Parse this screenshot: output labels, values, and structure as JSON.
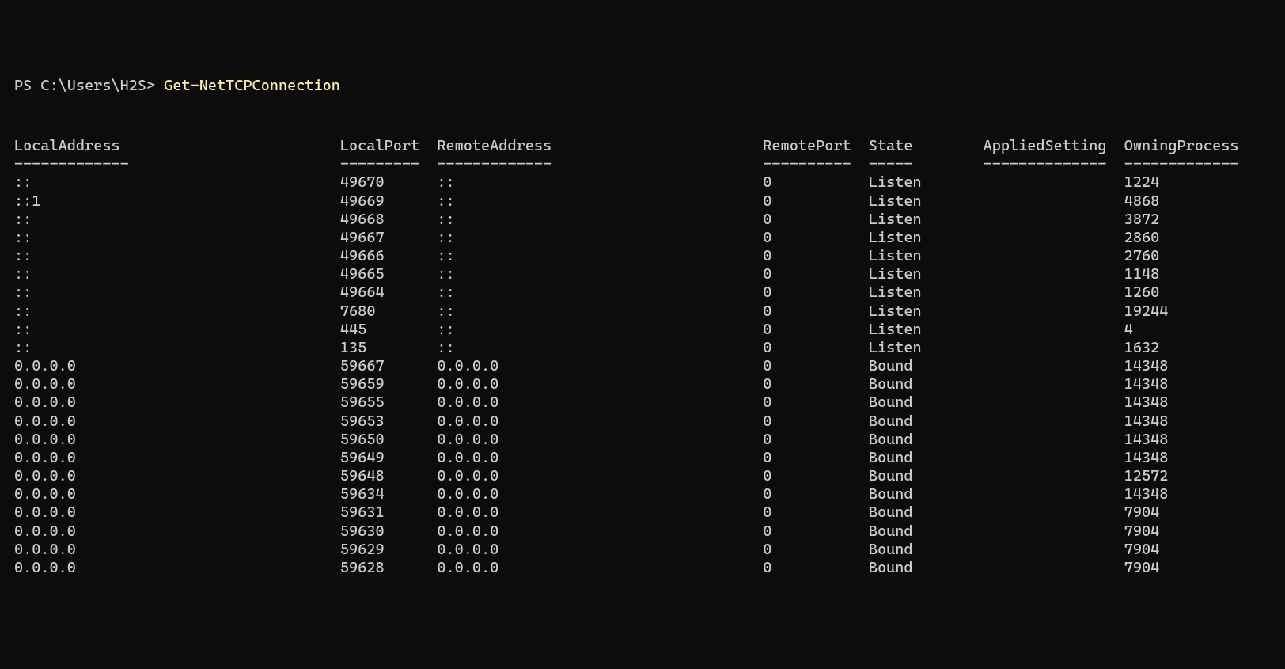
{
  "prompt": {
    "prefix": "PS C:\\Users\\H2S>",
    "command": "Get-NetTCPConnection"
  },
  "columns": [
    {
      "name": "LocalAddress",
      "width": 36,
      "rule": 13
    },
    {
      "name": "LocalPort",
      "width": 10,
      "rule": 9
    },
    {
      "name": "RemoteAddress",
      "width": 36,
      "rule": 13
    },
    {
      "name": "RemotePort",
      "width": 11,
      "rule": 10
    },
    {
      "name": "State",
      "width": 12,
      "rule": 5
    },
    {
      "name": "AppliedSetting",
      "width": 15,
      "rule": 14
    },
    {
      "name": "OwningProcess",
      "width": 14,
      "rule": 13
    }
  ],
  "rows": [
    {
      "LocalAddress": "::",
      "LocalPort": "49670",
      "RemoteAddress": "::",
      "RemotePort": "0",
      "State": "Listen",
      "AppliedSetting": "",
      "OwningProcess": "1224"
    },
    {
      "LocalAddress": "::1",
      "LocalPort": "49669",
      "RemoteAddress": "::",
      "RemotePort": "0",
      "State": "Listen",
      "AppliedSetting": "",
      "OwningProcess": "4868"
    },
    {
      "LocalAddress": "::",
      "LocalPort": "49668",
      "RemoteAddress": "::",
      "RemotePort": "0",
      "State": "Listen",
      "AppliedSetting": "",
      "OwningProcess": "3872"
    },
    {
      "LocalAddress": "::",
      "LocalPort": "49667",
      "RemoteAddress": "::",
      "RemotePort": "0",
      "State": "Listen",
      "AppliedSetting": "",
      "OwningProcess": "2860"
    },
    {
      "LocalAddress": "::",
      "LocalPort": "49666",
      "RemoteAddress": "::",
      "RemotePort": "0",
      "State": "Listen",
      "AppliedSetting": "",
      "OwningProcess": "2760"
    },
    {
      "LocalAddress": "::",
      "LocalPort": "49665",
      "RemoteAddress": "::",
      "RemotePort": "0",
      "State": "Listen",
      "AppliedSetting": "",
      "OwningProcess": "1148"
    },
    {
      "LocalAddress": "::",
      "LocalPort": "49664",
      "RemoteAddress": "::",
      "RemotePort": "0",
      "State": "Listen",
      "AppliedSetting": "",
      "OwningProcess": "1260"
    },
    {
      "LocalAddress": "::",
      "LocalPort": "7680",
      "RemoteAddress": "::",
      "RemotePort": "0",
      "State": "Listen",
      "AppliedSetting": "",
      "OwningProcess": "19244"
    },
    {
      "LocalAddress": "::",
      "LocalPort": "445",
      "RemoteAddress": "::",
      "RemotePort": "0",
      "State": "Listen",
      "AppliedSetting": "",
      "OwningProcess": "4"
    },
    {
      "LocalAddress": "::",
      "LocalPort": "135",
      "RemoteAddress": "::",
      "RemotePort": "0",
      "State": "Listen",
      "AppliedSetting": "",
      "OwningProcess": "1632"
    },
    {
      "LocalAddress": "0.0.0.0",
      "LocalPort": "59667",
      "RemoteAddress": "0.0.0.0",
      "RemotePort": "0",
      "State": "Bound",
      "AppliedSetting": "",
      "OwningProcess": "14348"
    },
    {
      "LocalAddress": "0.0.0.0",
      "LocalPort": "59659",
      "RemoteAddress": "0.0.0.0",
      "RemotePort": "0",
      "State": "Bound",
      "AppliedSetting": "",
      "OwningProcess": "14348"
    },
    {
      "LocalAddress": "0.0.0.0",
      "LocalPort": "59655",
      "RemoteAddress": "0.0.0.0",
      "RemotePort": "0",
      "State": "Bound",
      "AppliedSetting": "",
      "OwningProcess": "14348"
    },
    {
      "LocalAddress": "0.0.0.0",
      "LocalPort": "59653",
      "RemoteAddress": "0.0.0.0",
      "RemotePort": "0",
      "State": "Bound",
      "AppliedSetting": "",
      "OwningProcess": "14348"
    },
    {
      "LocalAddress": "0.0.0.0",
      "LocalPort": "59650",
      "RemoteAddress": "0.0.0.0",
      "RemotePort": "0",
      "State": "Bound",
      "AppliedSetting": "",
      "OwningProcess": "14348"
    },
    {
      "LocalAddress": "0.0.0.0",
      "LocalPort": "59649",
      "RemoteAddress": "0.0.0.0",
      "RemotePort": "0",
      "State": "Bound",
      "AppliedSetting": "",
      "OwningProcess": "14348"
    },
    {
      "LocalAddress": "0.0.0.0",
      "LocalPort": "59648",
      "RemoteAddress": "0.0.0.0",
      "RemotePort": "0",
      "State": "Bound",
      "AppliedSetting": "",
      "OwningProcess": "12572"
    },
    {
      "LocalAddress": "0.0.0.0",
      "LocalPort": "59634",
      "RemoteAddress": "0.0.0.0",
      "RemotePort": "0",
      "State": "Bound",
      "AppliedSetting": "",
      "OwningProcess": "14348"
    },
    {
      "LocalAddress": "0.0.0.0",
      "LocalPort": "59631",
      "RemoteAddress": "0.0.0.0",
      "RemotePort": "0",
      "State": "Bound",
      "AppliedSetting": "",
      "OwningProcess": "7904"
    },
    {
      "LocalAddress": "0.0.0.0",
      "LocalPort": "59630",
      "RemoteAddress": "0.0.0.0",
      "RemotePort": "0",
      "State": "Bound",
      "AppliedSetting": "",
      "OwningProcess": "7904"
    },
    {
      "LocalAddress": "0.0.0.0",
      "LocalPort": "59629",
      "RemoteAddress": "0.0.0.0",
      "RemotePort": "0",
      "State": "Bound",
      "AppliedSetting": "",
      "OwningProcess": "7904"
    },
    {
      "LocalAddress": "0.0.0.0",
      "LocalPort": "59628",
      "RemoteAddress": "0.0.0.0",
      "RemotePort": "0",
      "State": "Bound",
      "AppliedSetting": "",
      "OwningProcess": "7904"
    }
  ]
}
